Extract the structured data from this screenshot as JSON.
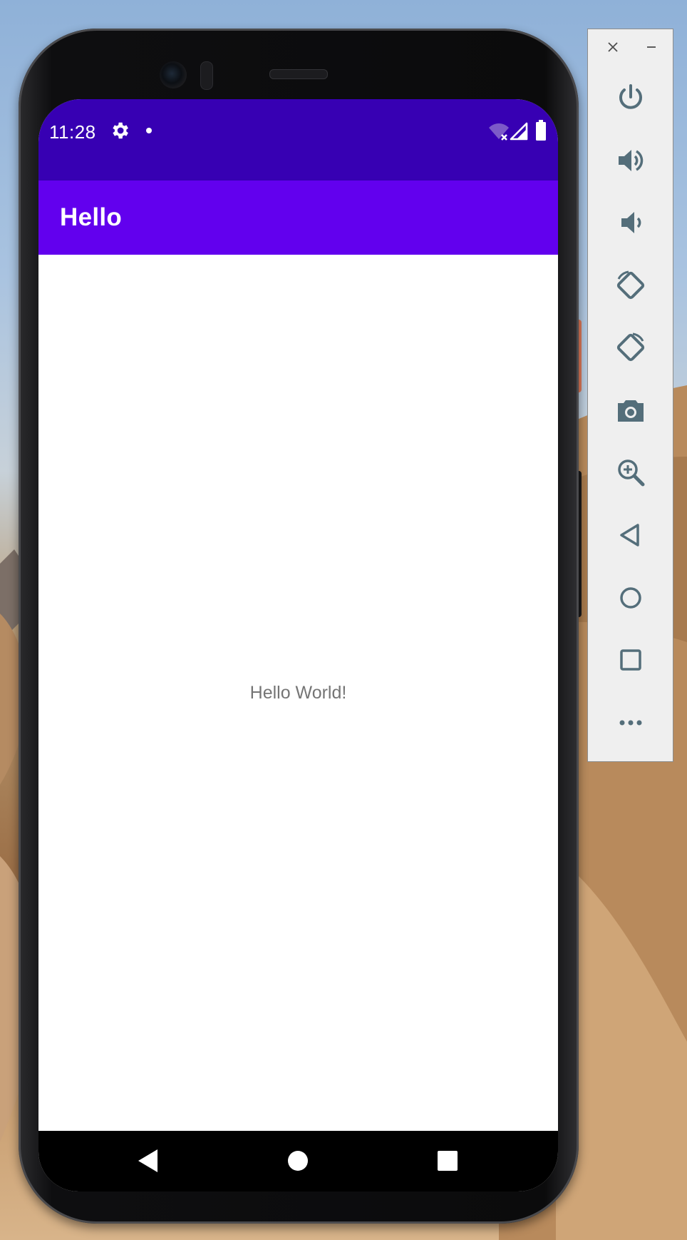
{
  "status_bar": {
    "time": "11:28",
    "icons": [
      "settings-icon",
      "notification-dot-icon",
      "wifi-off-icon",
      "cell-signal-icon",
      "battery-icon"
    ]
  },
  "app_bar": {
    "title": "Hello"
  },
  "content": {
    "message": "Hello World!"
  },
  "nav_bar": {
    "buttons": [
      "back-icon",
      "home-icon",
      "recents-icon"
    ]
  },
  "emulator_panel": {
    "window_controls": [
      "close-icon",
      "minimize-icon"
    ],
    "buttons": [
      "power-icon",
      "volume-up-icon",
      "volume-down-icon",
      "rotate-left-icon",
      "rotate-right-icon",
      "camera-icon",
      "zoom-icon",
      "back-icon",
      "home-icon",
      "overview-icon",
      "more-icon"
    ]
  },
  "colors": {
    "status_bar": "#3700b3",
    "app_bar": "#6200ee",
    "text_secondary": "#757575",
    "emulator_icon": "#546e7a"
  }
}
